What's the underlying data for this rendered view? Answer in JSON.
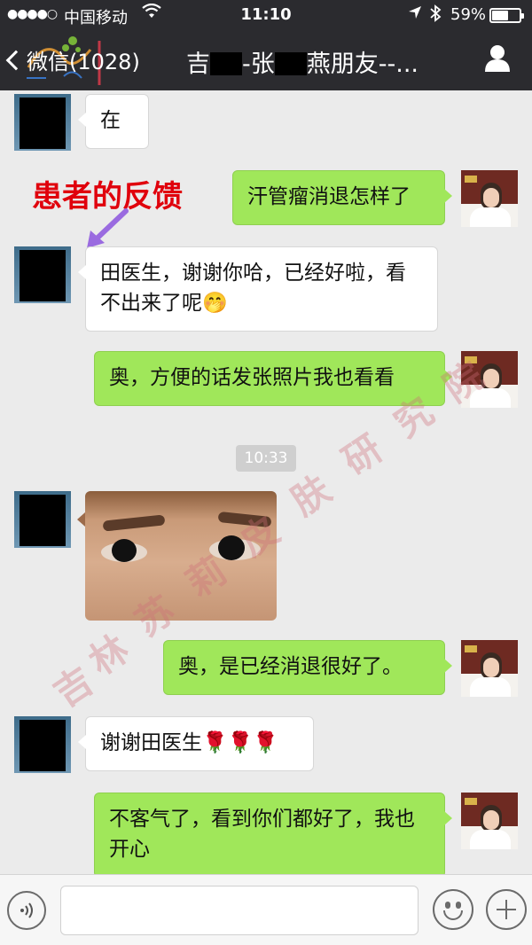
{
  "status_bar": {
    "signal": "●●●●○",
    "carrier": "中国移动",
    "time": "11:10",
    "battery_percent": "59%",
    "battery_level": 0.59
  },
  "nav": {
    "back_label": "微信(1028)",
    "title_parts": [
      "吉",
      "-张",
      "燕朋友--..."
    ]
  },
  "annotation": {
    "label": "患者的反馈",
    "color": "#e0000c"
  },
  "messages": [
    {
      "side": "left",
      "text": "在"
    },
    {
      "side": "right",
      "text": "汗管瘤消退怎样了"
    },
    {
      "side": "left",
      "text": "田医生，谢谢你哈，已经好啦，看不出来了呢🤭"
    },
    {
      "side": "right",
      "text": "奥，方便的话发张照片我也看看"
    },
    {
      "side": "left",
      "type": "image",
      "text": ""
    },
    {
      "side": "right",
      "text": "奥，是已经消退很好了。"
    },
    {
      "side": "left",
      "text": "谢谢田医生🌹🌹🌹"
    },
    {
      "side": "right",
      "text": "不客气了，看到你们都好了，我也开心"
    }
  ],
  "time_chip": "10:33",
  "watermark": [
    "吉",
    "林",
    "苏",
    "莉",
    "皮",
    "肤",
    "研",
    "究",
    "院"
  ],
  "input": {
    "value": "",
    "voice_icon": "voice-icon",
    "emoji_icon": "emoji-icon",
    "plus_icon": "plus-icon"
  },
  "colors": {
    "header_bg": "#2b2b2f",
    "chat_bg": "#ebebeb",
    "right_bubble": "#a0e75a",
    "left_bubble": "#ffffff"
  }
}
